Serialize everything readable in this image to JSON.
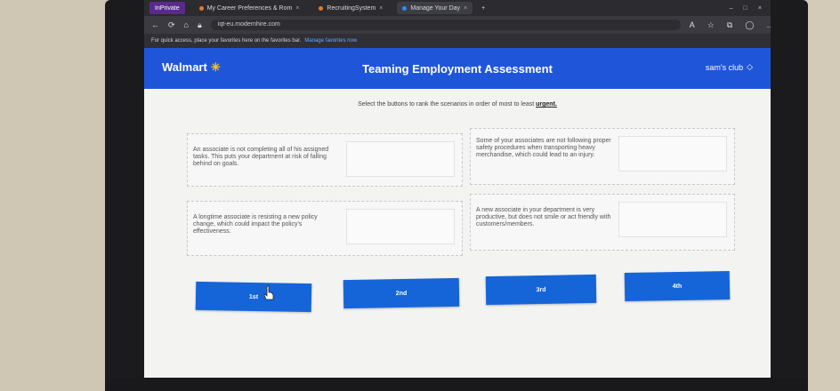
{
  "browser": {
    "tabs": [
      {
        "label": "InPrivate",
        "kind": "private"
      },
      {
        "label": "My Career Preferences & Rom",
        "kind": "normal"
      },
      {
        "label": "RecruitingSystem",
        "kind": "normal"
      },
      {
        "label": "Manage Your Day",
        "kind": "active"
      }
    ],
    "url": "iqt-eu.modernhire.com",
    "favorites_bar_text": "For quick access, place your favorites here on the favorites bar.",
    "favorites_bar_link": "Manage favorites now"
  },
  "header": {
    "logo_text": "Walmart",
    "title": "Teaming Employment Assessment",
    "right_brand": "sam's club"
  },
  "main": {
    "instruction_prefix": "Select the buttons to rank the scenarios in order of most to least",
    "instruction_emphasis": "urgent."
  },
  "scenarios": [
    "An associate is not completing all of his assigned tasks. This puts your department at risk of falling behind on goals.",
    "Some of your associates are not following proper safety procedures when transporting heavy merchandise, which could lead to an injury.",
    "A longtime associate is resisting a new policy change, which could impact the policy's effectiveness.",
    "A new associate in your department is very productive, but does not smile or act friendly with customers/members."
  ],
  "rank_buttons": [
    "1st",
    "2nd",
    "3rd",
    "4th"
  ],
  "colors": {
    "header": "#1f55d8",
    "button": "#1565d8",
    "spark": "#ffc220"
  }
}
